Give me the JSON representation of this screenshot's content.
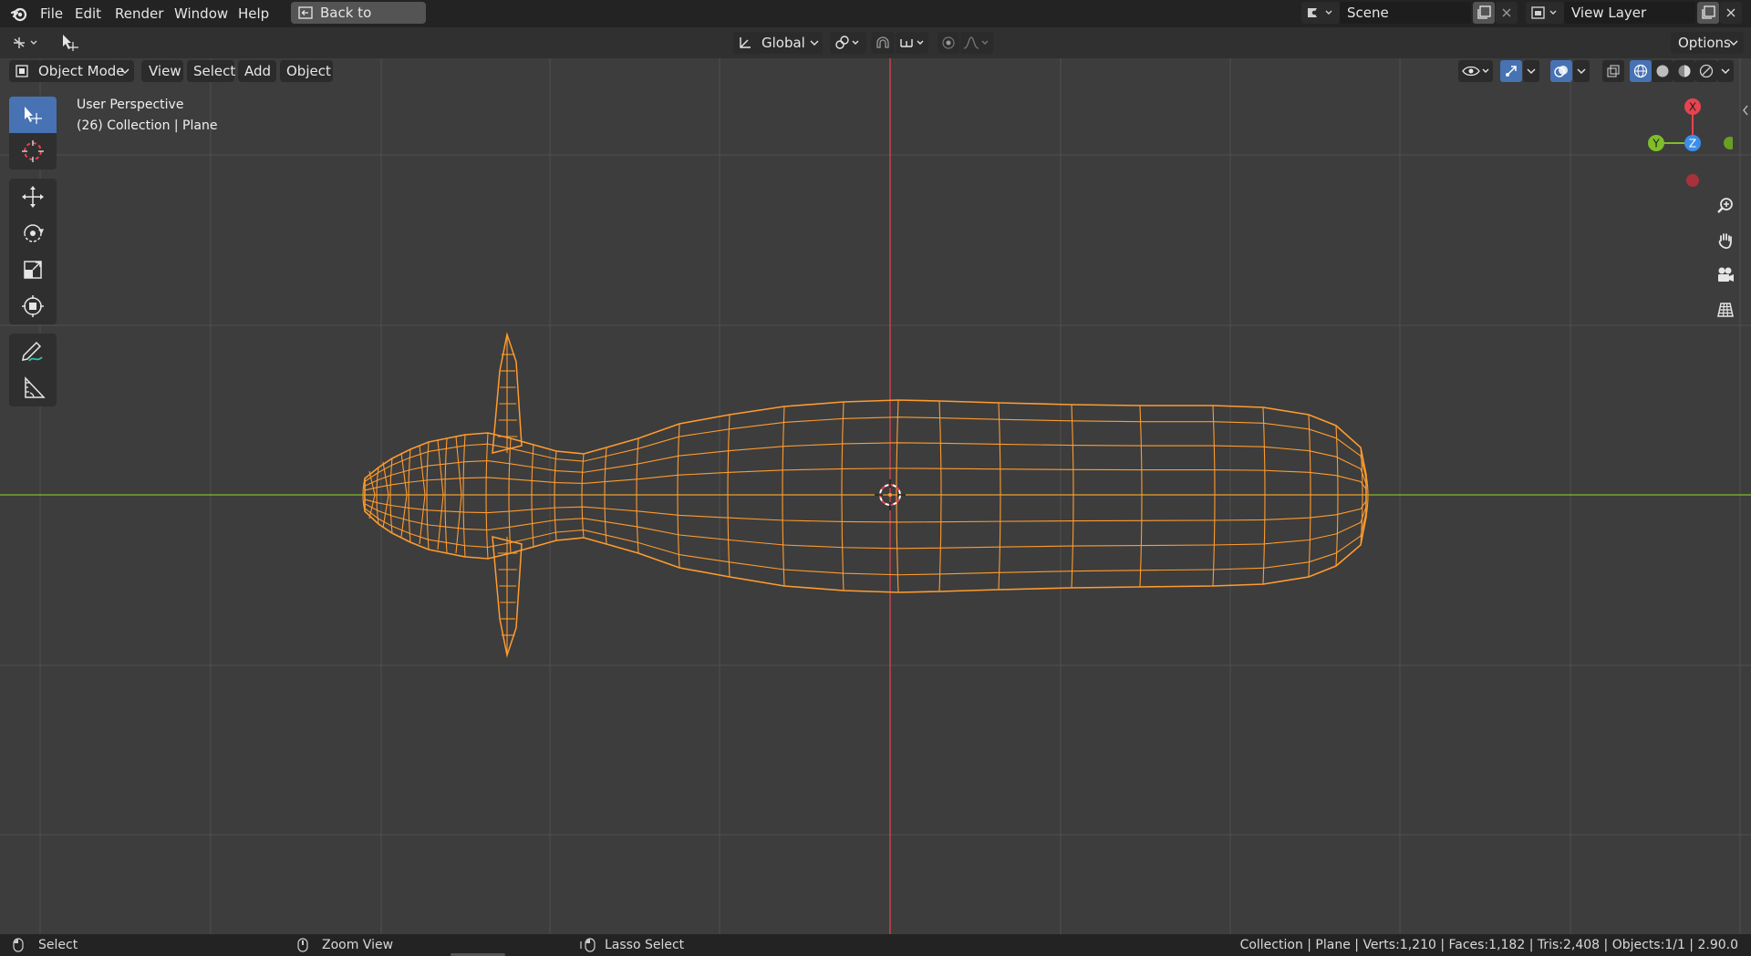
{
  "topbar": {
    "menus": [
      "File",
      "Edit",
      "Render",
      "Window",
      "Help"
    ],
    "back_button": "Back to Previous",
    "scene_name": "Scene",
    "view_layer_name": "View Layer"
  },
  "tool_header": {
    "transform_orientation": "Global",
    "options_label": "Options"
  },
  "viewport_header": {
    "mode": "Object Mode",
    "menus": [
      "View",
      "Select",
      "Add",
      "Object"
    ]
  },
  "viewport": {
    "perspective_label": "User Perspective",
    "collection_label": "(26) Collection | Plane",
    "gizmo": {
      "x_label": "X",
      "y_label": "Y",
      "z_label": "Z"
    }
  },
  "statusbar": {
    "select": "Select",
    "zoom_view": "Zoom View",
    "lasso_select": "Lasso Select",
    "stats": "Collection | Plane | Verts:1,210 | Faces:1,182 | Tris:2,408 | Objects:1/1 | 2.90.0"
  },
  "colors": {
    "wire": "#ff9b2e",
    "x_axis": "#e8434f",
    "y_axis": "#7fbd2a",
    "z_axis": "#3b8eea",
    "active_tool": "#4772b3"
  },
  "icons": [
    "blender-logo-icon",
    "select-box-icon",
    "cursor-icon",
    "move-icon",
    "rotate-icon",
    "scale-icon",
    "transform-icon",
    "annotate-icon",
    "measure-icon",
    "zoom-icon",
    "hand-icon",
    "camera-icon",
    "grid-icon"
  ]
}
